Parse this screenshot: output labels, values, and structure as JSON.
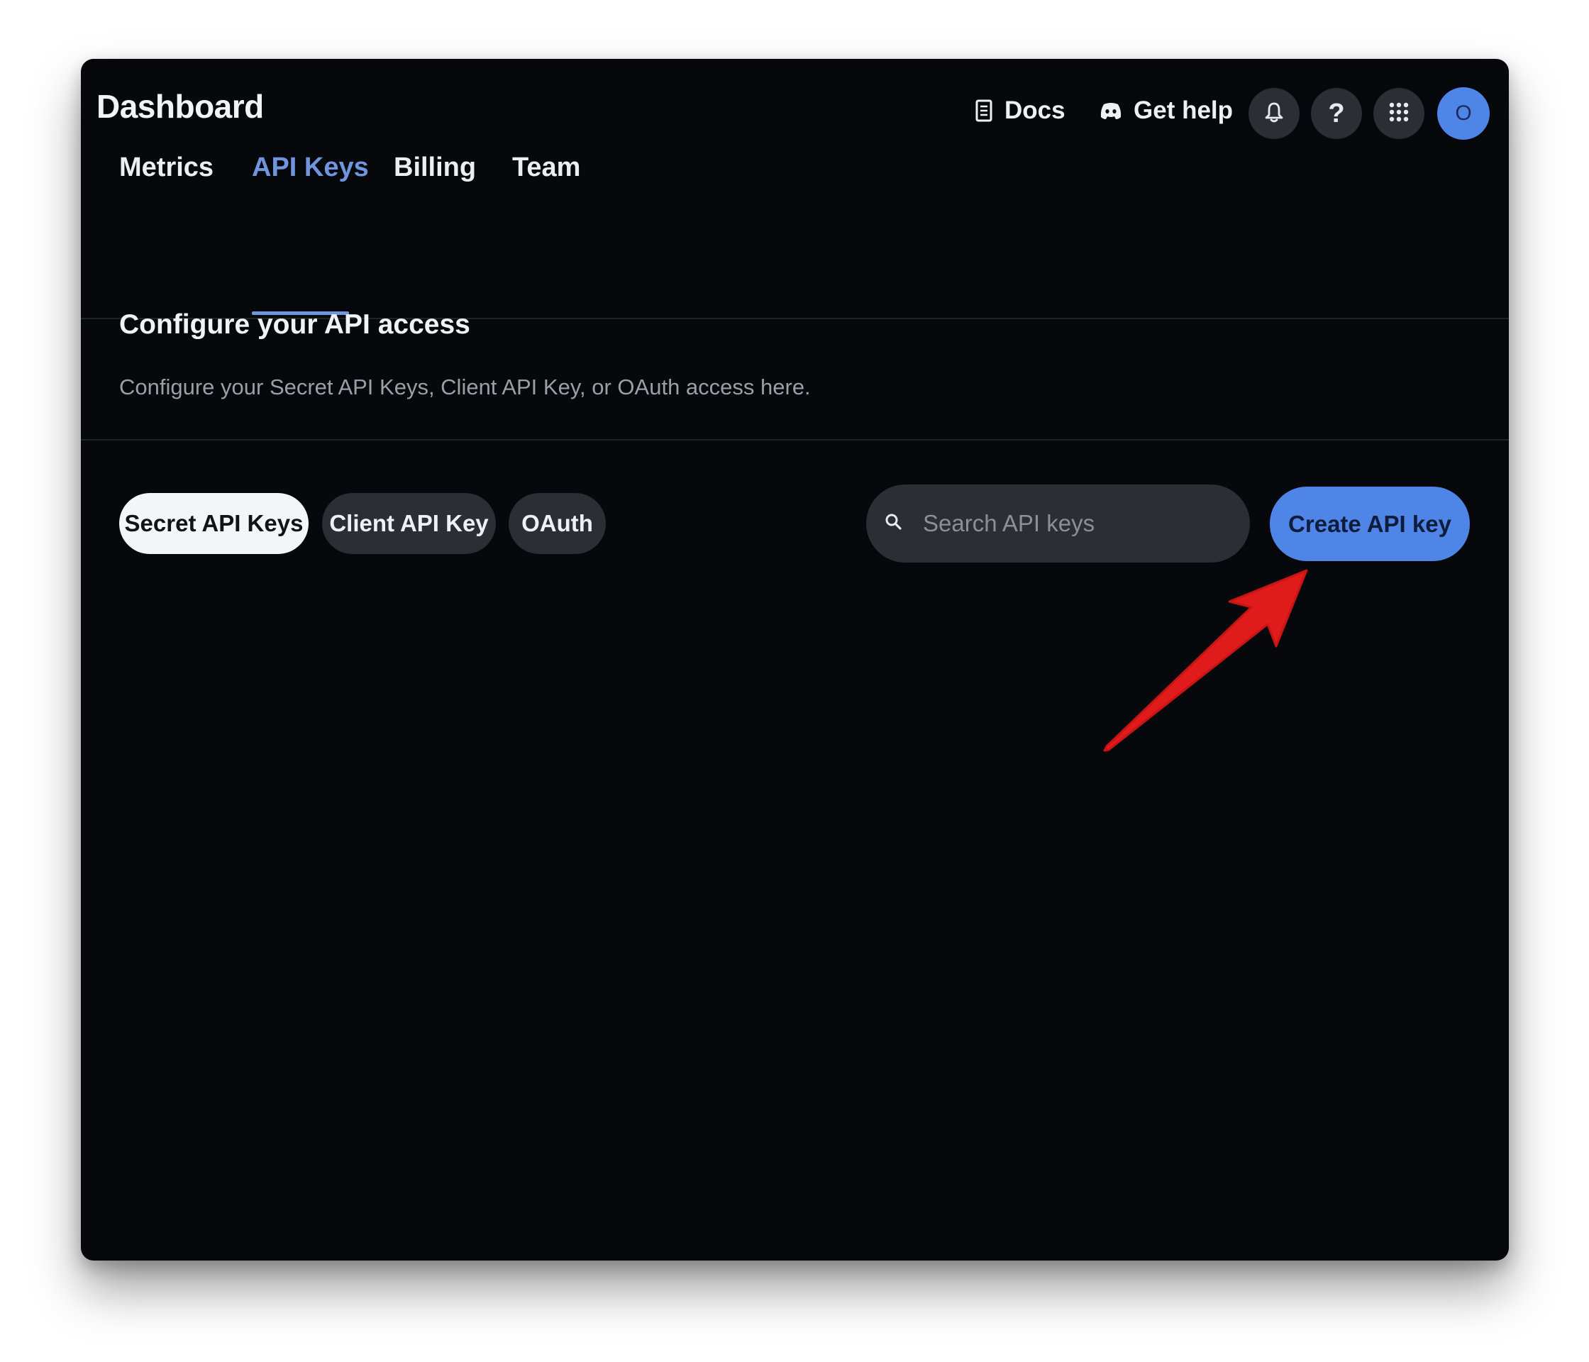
{
  "header": {
    "title": "Dashboard",
    "docs_label": "Docs",
    "help_label": "Get help",
    "help_glyph": "?",
    "avatar_initial": "O",
    "icons": [
      "document-icon",
      "discord-icon",
      "bell-icon",
      "question-icon",
      "grid-icon"
    ]
  },
  "tabs": [
    {
      "label": "Metrics",
      "active": false
    },
    {
      "label": "API Keys",
      "active": true
    },
    {
      "label": "Billing",
      "active": false
    },
    {
      "label": "Team",
      "active": false
    }
  ],
  "section": {
    "title": "Configure your API access",
    "description": "Configure your Secret API Keys, Client API Key, or OAuth access here."
  },
  "filters": [
    {
      "label": "Secret API Keys",
      "selected": true
    },
    {
      "label": "Client API Key",
      "selected": false
    },
    {
      "label": "OAuth",
      "selected": false
    }
  ],
  "search": {
    "placeholder": "Search API keys",
    "value": ""
  },
  "actions": {
    "create_label": "Create API key"
  },
  "colors": {
    "background": "#07080b",
    "accent": "#4e85e7",
    "active_tab": "#6f95de",
    "control_bg": "#2b2e35",
    "annotation_arrow": "#e01b1b"
  }
}
